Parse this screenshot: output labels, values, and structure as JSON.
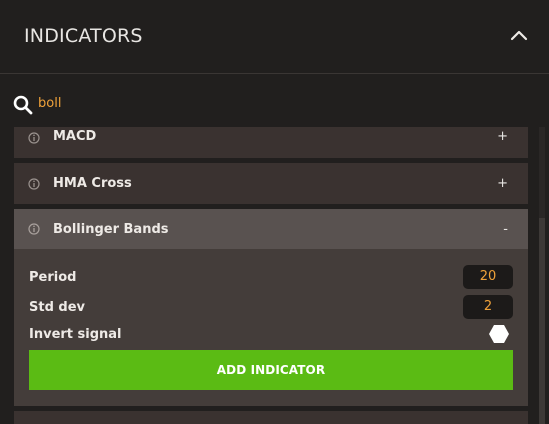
{
  "header": {
    "title": "INDICATORS",
    "collapse_icon": "chevron-up-icon"
  },
  "search": {
    "value": "boll",
    "icon": "search-icon"
  },
  "indicators": [
    {
      "name": "MACD",
      "toggle": "+",
      "icon": "info-icon"
    },
    {
      "name": "HMA Cross",
      "toggle": "+",
      "icon": "info-icon"
    },
    {
      "name": "Bollinger Bands",
      "toggle": "-",
      "icon": "info-icon"
    }
  ],
  "bollinger_params": {
    "period_label": "Period",
    "period_value": "20",
    "std_label": "Std dev",
    "std_value": "2",
    "invert_label": "Invert signal",
    "invert_on": false
  },
  "add_button": {
    "label": "ADD INDICATOR"
  },
  "colors": {
    "accent": "#f0a23a",
    "button": "#5bbb14",
    "background": "#211f1e"
  }
}
